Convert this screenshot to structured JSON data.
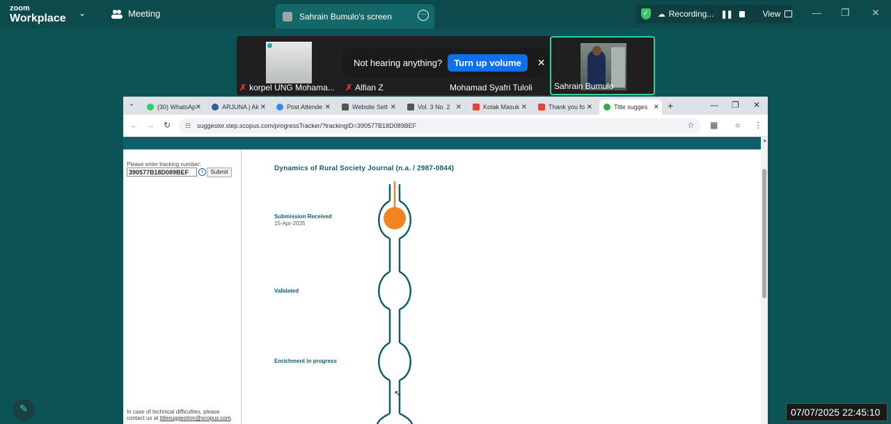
{
  "zoom": {
    "logo_top": "zoom",
    "logo_bottom": "Workplace",
    "meeting_label": "Meeting",
    "screen_tab_label": "Sahrain Bumulo's screen",
    "recording_label": "Recording...",
    "view_label": "View",
    "icons": [
      "chevron-down-icon",
      "meeting-icon",
      "more-icon",
      "shield-check-icon",
      "cloud-icon",
      "pause-icon",
      "stop-icon",
      "view-grid-icon"
    ]
  },
  "participants": [
    {
      "name": "korpel UNG Mohama...",
      "muted": true
    },
    {
      "name": "Alfian Z",
      "muted": true
    },
    {
      "name": "Mohamad Syafri Tuloli",
      "muted": false
    },
    {
      "name": "Sahrain Bumulo",
      "muted": false
    }
  ],
  "toast": {
    "message": "Not hearing anything?",
    "button": "Turn up volume"
  },
  "browser": {
    "tabs": [
      {
        "title": "(30) WhatsAp",
        "fav_color": "#25d366"
      },
      {
        "title": "ARJUNA | Ak",
        "fav_color": "#3b5998"
      },
      {
        "title": "Post Attende",
        "fav_color": "#2d8cff"
      },
      {
        "title": "Website Sett",
        "fav_color": "#555555"
      },
      {
        "title": "Vol. 3 No. 2",
        "fav_color": "#555555"
      },
      {
        "title": "Kotak Masuk",
        "fav_color": "#ea4335"
      },
      {
        "title": "Thank you fo",
        "fav_color": "#ea4335"
      },
      {
        "title": "Title sugges",
        "fav_color": "#34a853"
      }
    ],
    "url": "suggestor.step.scopus.com/progressTracker/?trackingID=390577B18D089BEF"
  },
  "page": {
    "tracking_label": "Please enter tracking number:",
    "tracking_value": "390577B18D089BEF",
    "submit_label": "Submit",
    "help_line1": "In case of technical difficulties, please",
    "help_prefix": "contact us at ",
    "help_email": "titlesuggestion@scopus.com",
    "help_suffix": ".",
    "journal_title": "Dynamics of Rural Society Journal (n.a. / 2987-0844)",
    "steps": [
      {
        "label": "Submission Received",
        "date": "15-Apr-2025",
        "done": true
      },
      {
        "label": "Validated",
        "date": "",
        "done": false
      },
      {
        "label": "Enrichment in progress",
        "date": "",
        "done": false
      }
    ],
    "colors": {
      "brand": "#0f5f68",
      "accent": "#f58220"
    }
  },
  "clock": "07/07/2025 22:45:10"
}
